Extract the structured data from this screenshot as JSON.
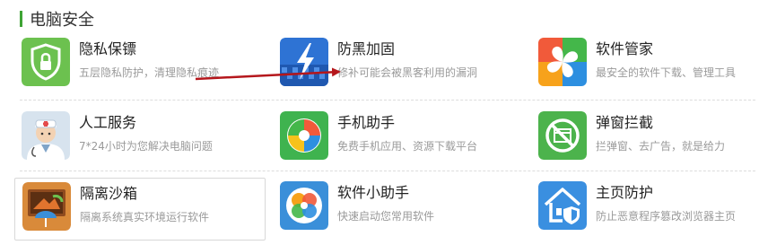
{
  "section": {
    "title": "电脑安全"
  },
  "tools": [
    {
      "name": "隐私保镖",
      "desc": "五层隐私防护，清理隐私痕迹",
      "icon": "shield-lock-icon",
      "color": "#6cc14f"
    },
    {
      "name": "防黑加固",
      "desc": "修补可能会被黑客利用的漏洞",
      "icon": "lightning-shield-icon",
      "color": "#2e73d4"
    },
    {
      "name": "软件管家",
      "desc": "最安全的软件下载、管理工具",
      "icon": "four-petal-icon",
      "color": "#f7a21b"
    },
    {
      "name": "人工服务",
      "desc": "7*24小时为您解决电脑问题",
      "icon": "doctor-avatar-icon",
      "color": "#9fb8cf"
    },
    {
      "name": "手机助手",
      "desc": "免费手机应用、资源下载平台",
      "icon": "color-wheel-icon",
      "color": "#3fb34f"
    },
    {
      "name": "弹窗拦截",
      "desc": "拦弹窗、去广告，就是给力",
      "icon": "no-popup-icon",
      "color": "#4cb34c"
    },
    {
      "name": "隔离沙箱",
      "desc": "隔离系统真实环境运行软件",
      "icon": "sandbox-umbrella-icon",
      "color": "#d98a3a"
    },
    {
      "name": "软件小助手",
      "desc": "快速启动您常用软件",
      "icon": "rings-icon",
      "color": "#3a8fd9"
    },
    {
      "name": "主页防护",
      "desc": "防止恶意程序篡改浏览器主页",
      "icon": "home-shield-icon",
      "color": "#3a8fe0"
    }
  ],
  "arrow_color": "#b5171c"
}
